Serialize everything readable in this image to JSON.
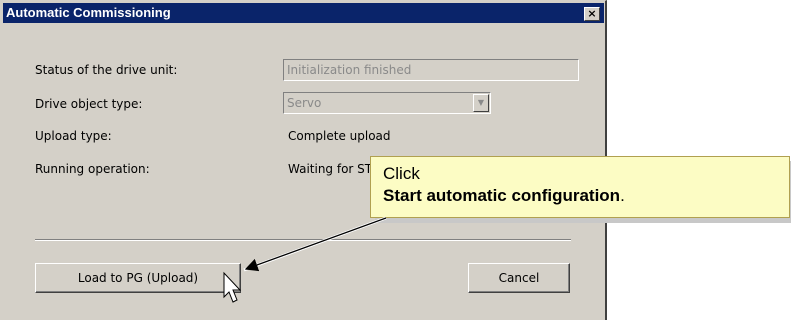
{
  "window": {
    "title": "Automatic Commissioning",
    "close_label": "×"
  },
  "form": {
    "status_label": "Status of the drive unit:",
    "status_value": "Initialization finished",
    "object_type_label": "Drive object type:",
    "object_type_value": "Servo",
    "upload_type_label": "Upload type:",
    "upload_type_value": "Complete upload",
    "running_op_label": "Running operation:",
    "running_op_value": "Waiting for ST"
  },
  "buttons": {
    "load_label": "Load to PG (Upload)",
    "cancel_label": "Cancel"
  },
  "callout": {
    "line1": "Click",
    "line2_bold": "Start automatic configuration",
    "line2_suffix": ".",
    "color": "#fcfcc4"
  },
  "colors": {
    "titlebar": "#0a246a",
    "dialog_bg": "#d4d0c8"
  }
}
